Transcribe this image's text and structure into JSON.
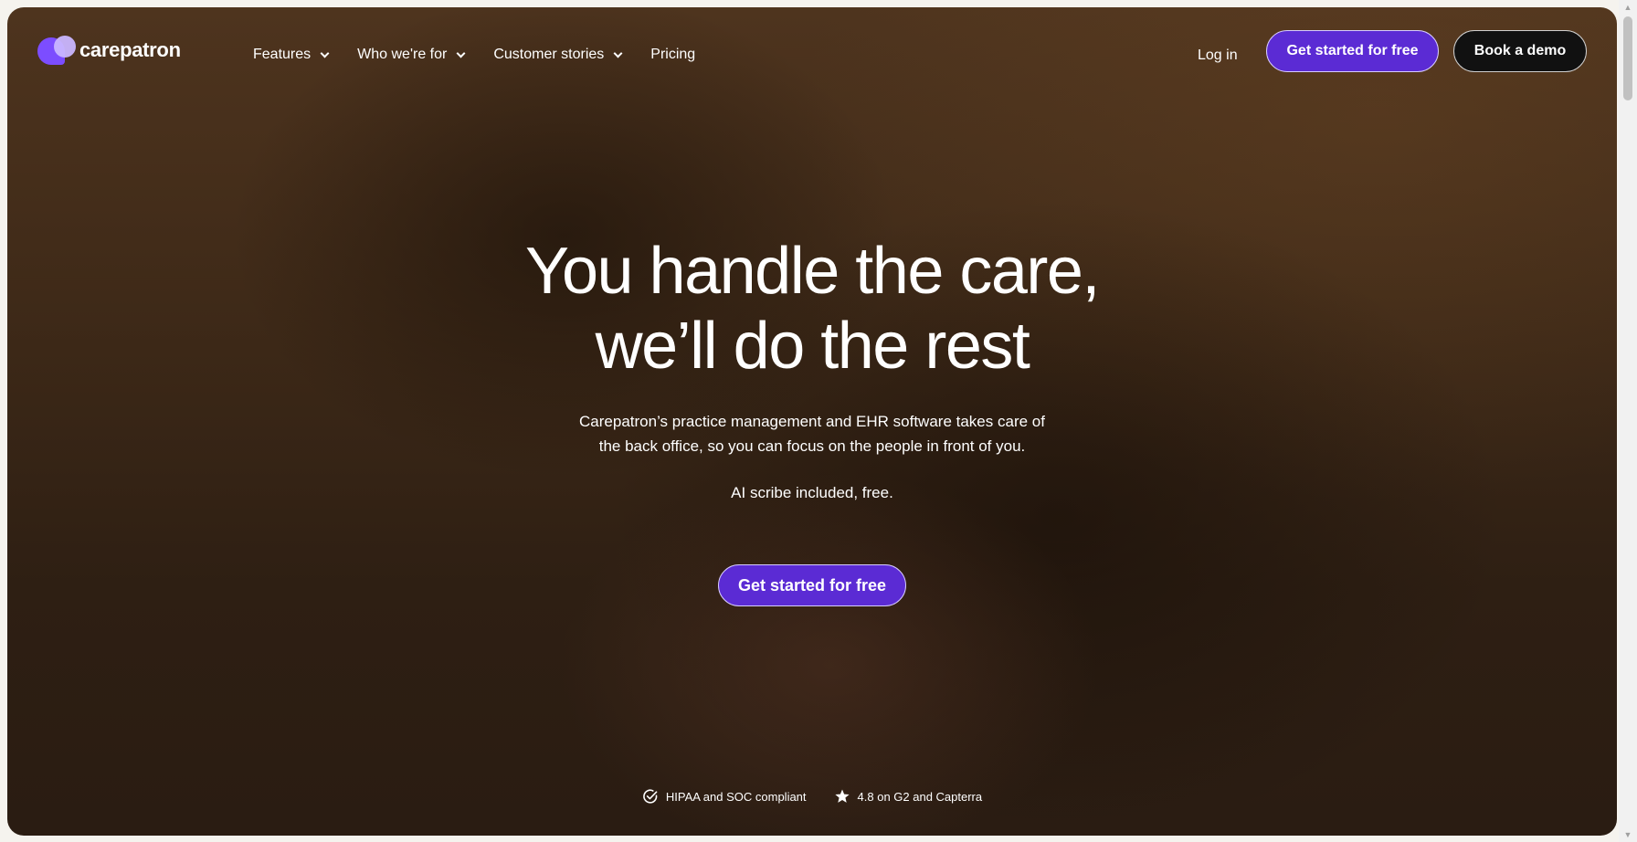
{
  "brand": {
    "name": "carepatron",
    "mark_primary": "#7c4dff",
    "mark_secondary": "#c9b6ff"
  },
  "nav": {
    "items": [
      {
        "label": "Features",
        "has_dropdown": true
      },
      {
        "label": "Who we're for",
        "has_dropdown": true
      },
      {
        "label": "Customer stories",
        "has_dropdown": true
      },
      {
        "label": "Pricing",
        "has_dropdown": false
      }
    ],
    "login_label": "Log in",
    "get_started_label": "Get started for free",
    "book_demo_label": "Book a demo"
  },
  "hero": {
    "title_line1": "You handle the care,",
    "title_line2": "we’ll do the rest",
    "subtitle_line1": "Carepatron’s practice management and EHR software takes care of",
    "subtitle_line2": "the back office, so you can focus on the people in front of you.",
    "ai_note": "AI scribe included, free.",
    "cta_label": "Get started for free"
  },
  "badges": [
    {
      "icon": "check-circle-icon",
      "label": "HIPAA and SOC compliant"
    },
    {
      "icon": "star-icon",
      "label": "4.8 on G2 and Capterra"
    }
  ],
  "colors": {
    "accent": "#5b2bd4",
    "demo_button": "#111111"
  }
}
